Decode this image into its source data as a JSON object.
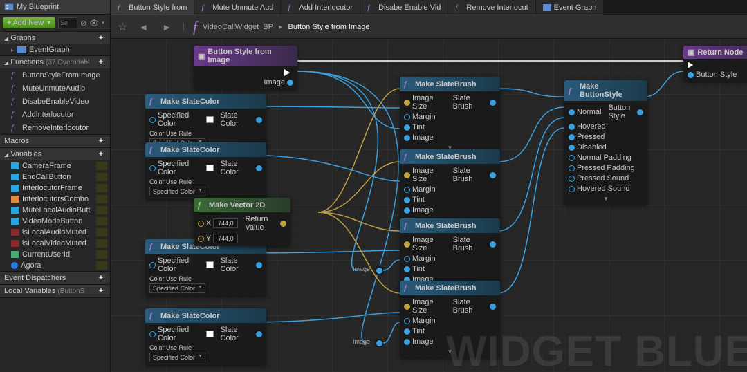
{
  "sidebar": {
    "title": "My Blueprint",
    "add_new": "Add New",
    "search_placeholder": "Se",
    "sections": {
      "graphs": {
        "label": "Graphs",
        "items": [
          "EventGraph"
        ]
      },
      "functions": {
        "label": "Functions",
        "override_count": "(37 Overridabl",
        "items": [
          "ButtonStyleFromImage",
          "MuteUnmuteAudio",
          "DisabeEnableVideo",
          "AddInterlocutor",
          "RemoveInterlocutor"
        ]
      },
      "macros": {
        "label": "Macros"
      },
      "variables": {
        "label": "Variables",
        "items": [
          {
            "name": "CameraFrame",
            "color": "#2aa5e0"
          },
          {
            "name": "EndCallButton",
            "color": "#2aa5e0"
          },
          {
            "name": "InterlocutorFrame",
            "color": "#2aa5e0"
          },
          {
            "name": "InterlocutorsCombo",
            "color": "#e08a40",
            "strip": true
          },
          {
            "name": "MuteLocalAudioButt",
            "color": "#2aa5e0"
          },
          {
            "name": "VideoModeButton",
            "color": "#2aa5e0"
          },
          {
            "name": "isLocalAudioMuted",
            "color": "#8a2a2a"
          },
          {
            "name": "isLocalVideoMuted",
            "color": "#8a2a2a"
          },
          {
            "name": "CurrentUserId",
            "color": "#4aaa7a"
          },
          {
            "name": "Agora",
            "color": "#2a7ae0",
            "round": true
          }
        ]
      },
      "event_dispatchers": {
        "label": "Event Dispatchers"
      },
      "local_vars": {
        "label": "Local Variables",
        "suffix": "(ButtonS"
      }
    }
  },
  "tabs": [
    {
      "label": "Button Style from",
      "type": "fn",
      "active": true
    },
    {
      "label": "Mute Unmute Aud",
      "type": "fn"
    },
    {
      "label": "Add Interlocutor",
      "type": "fn"
    },
    {
      "label": "Disabe Enable Vid",
      "type": "fn"
    },
    {
      "label": "Remove Interlocut",
      "type": "fn"
    },
    {
      "label": "Event Graph",
      "type": "eg"
    }
  ],
  "breadcrumb": {
    "parent": "VideoCallWidget_BP",
    "current": "Button Style from Image"
  },
  "watermark": "WIDGET BLUE",
  "nodes": {
    "entry": {
      "title": "Button Style from Image",
      "out_pin": "Image"
    },
    "return": {
      "title": "Return Node",
      "in_pin": "Button Style"
    },
    "slatecolor": {
      "title": "Make SlateColor",
      "p1": "Specified Color",
      "p2": "Color Use Rule",
      "dd": "Specified Color",
      "out": "Slate Color"
    },
    "vector2d": {
      "title": "Make Vector 2D",
      "x": "X",
      "y": "Y",
      "xv": "744,0",
      "yv": "744,0",
      "out": "Return Value"
    },
    "slatebrush": {
      "title": "Make SlateBrush",
      "p1": "Image Size",
      "p2": "Margin",
      "p3": "Tint",
      "p4": "Image",
      "out": "Slate Brush"
    },
    "buttonstyle": {
      "title": "Make ButtonStyle",
      "pins": [
        "Normal",
        "Hovered",
        "Pressed",
        "Disabled",
        "Normal Padding",
        "Pressed Padding",
        "Pressed Sound",
        "Hovered Sound"
      ],
      "out": "Button Style"
    },
    "image_reroute": "Image"
  }
}
